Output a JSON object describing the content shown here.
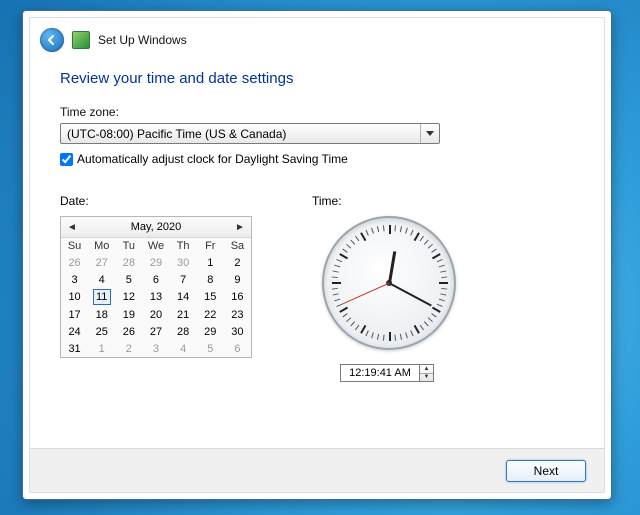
{
  "header": {
    "wizard_title": "Set Up Windows"
  },
  "page": {
    "heading": "Review your time and date settings",
    "timezone_label": "Time zone:",
    "timezone_value": "(UTC-08:00) Pacific Time (US & Canada)",
    "dst_label": "Automatically adjust clock for Daylight Saving Time",
    "dst_checked": true,
    "date_label": "Date:",
    "time_label": "Time:"
  },
  "calendar": {
    "month_label": "May, 2020",
    "dow": [
      "Su",
      "Mo",
      "Tu",
      "We",
      "Th",
      "Fr",
      "Sa"
    ],
    "rows": [
      [
        {
          "d": 26,
          "o": true
        },
        {
          "d": 27,
          "o": true
        },
        {
          "d": 28,
          "o": true
        },
        {
          "d": 29,
          "o": true
        },
        {
          "d": 30,
          "o": true
        },
        {
          "d": 1
        },
        {
          "d": 2
        }
      ],
      [
        {
          "d": 3
        },
        {
          "d": 4
        },
        {
          "d": 5
        },
        {
          "d": 6
        },
        {
          "d": 7
        },
        {
          "d": 8
        },
        {
          "d": 9
        }
      ],
      [
        {
          "d": 10
        },
        {
          "d": 11,
          "today": true
        },
        {
          "d": 12
        },
        {
          "d": 13
        },
        {
          "d": 14
        },
        {
          "d": 15
        },
        {
          "d": 16
        }
      ],
      [
        {
          "d": 17
        },
        {
          "d": 18
        },
        {
          "d": 19
        },
        {
          "d": 20
        },
        {
          "d": 21
        },
        {
          "d": 22
        },
        {
          "d": 23
        }
      ],
      [
        {
          "d": 24
        },
        {
          "d": 25
        },
        {
          "d": 26
        },
        {
          "d": 27
        },
        {
          "d": 28
        },
        {
          "d": 29
        },
        {
          "d": 30
        }
      ],
      [
        {
          "d": 31
        },
        {
          "d": 1,
          "o": true
        },
        {
          "d": 2,
          "o": true
        },
        {
          "d": 3,
          "o": true
        },
        {
          "d": 4,
          "o": true
        },
        {
          "d": 5,
          "o": true
        },
        {
          "d": 6,
          "o": true
        }
      ]
    ]
  },
  "clock": {
    "time_text": "12:19:41 AM",
    "hours": 0,
    "minutes": 19,
    "seconds": 41
  },
  "footer": {
    "next_label": "Next"
  }
}
